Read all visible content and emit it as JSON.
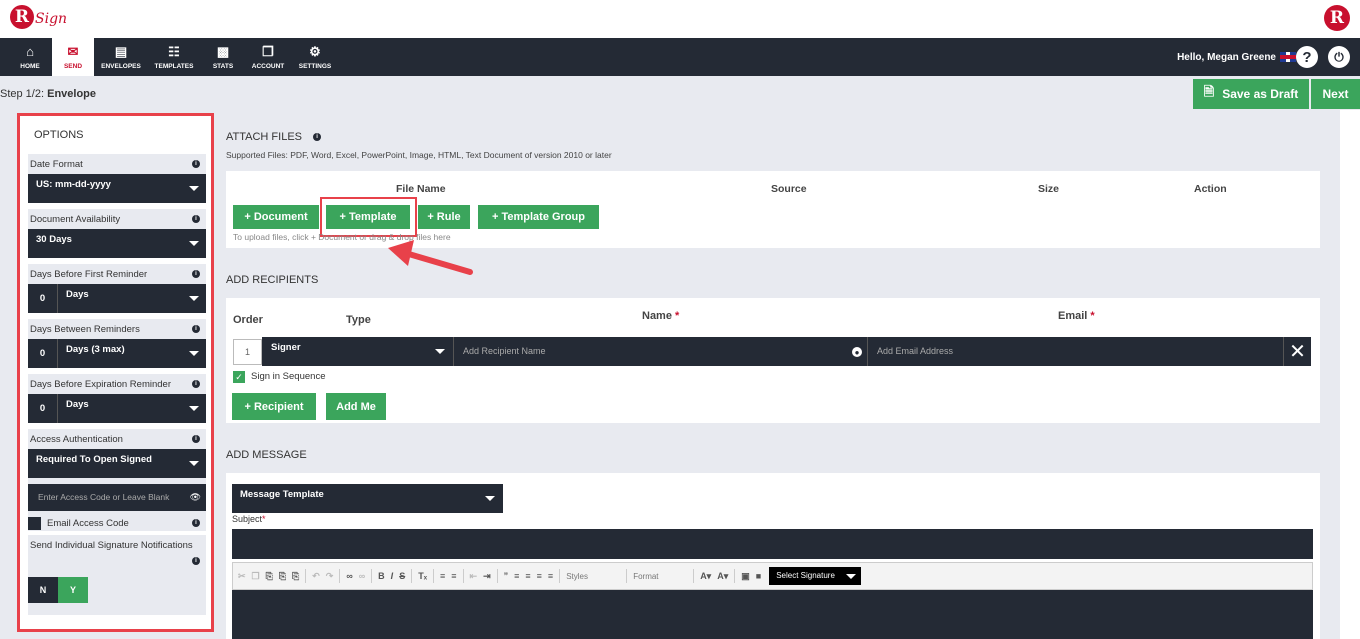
{
  "brand": {
    "logo_letter": "R",
    "logo_text": "Sign",
    "right_logo_letter": "R"
  },
  "nav": {
    "items": [
      {
        "label": "HOME",
        "icon": "home-icon"
      },
      {
        "label": "SEND",
        "icon": "envelope-icon"
      },
      {
        "label": "ENVELOPES",
        "icon": "inbox-icon"
      },
      {
        "label": "TEMPLATES",
        "icon": "templates-icon"
      },
      {
        "label": "STATS",
        "icon": "stats-icon"
      },
      {
        "label": "ACCOUNT",
        "icon": "account-icon"
      },
      {
        "label": "SETTINGS",
        "icon": "gear-icon"
      }
    ],
    "active": "SEND",
    "greeting": "Hello, Megan Greene"
  },
  "step": {
    "prefix": "Step 1/2:",
    "title": "Envelope"
  },
  "actions": {
    "save_draft": "Save as Draft",
    "next": "Next"
  },
  "options": {
    "title": "OPTIONS",
    "date_format": {
      "label": "Date Format",
      "value": "US: mm-dd-yyyy"
    },
    "doc_availability": {
      "label": "Document Availability",
      "value": "30 Days"
    },
    "first_reminder": {
      "label": "Days Before First Reminder",
      "num": "0",
      "value": "Days"
    },
    "between_reminders": {
      "label": "Days Between Reminders",
      "num": "0",
      "value": "Days (3 max)"
    },
    "expiration_reminder": {
      "label": "Days Before Expiration Reminder",
      "num": "0",
      "value": "Days"
    },
    "access_auth": {
      "label": "Access Authentication",
      "value": "Required To Open Signed",
      "code_placeholder": "Enter Access Code or Leave Blank"
    },
    "email_access_code": "Email Access Code",
    "individual_notifications": {
      "label": "Send Individual Signature Notifications",
      "no": "N",
      "yes": "Y"
    }
  },
  "attach": {
    "title": "ATTACH FILES",
    "supported": "Supported Files: PDF, Word, Excel, PowerPoint, Image, HTML, Text Document of version 2010 or later",
    "columns": [
      "File Name",
      "Source",
      "Size",
      "Action"
    ],
    "buttons": {
      "document": "+ Document",
      "template": "+ Template",
      "rule": "+ Rule",
      "template_group": "+ Template Group"
    },
    "hint": "To upload files, click + Document or drag & drop files here"
  },
  "recipients": {
    "title": "ADD RECIPIENTS",
    "columns": {
      "order": "Order",
      "type": "Type",
      "name": "Name",
      "email": "Email"
    },
    "row": {
      "order": "1",
      "type": "Signer",
      "name_placeholder": "Add Recipient Name",
      "email_placeholder": "Add Email Address"
    },
    "sign_in_sequence": "Sign in Sequence",
    "buttons": {
      "recipient": "+ Recipient",
      "add_me": "Add Me"
    }
  },
  "message": {
    "title": "ADD MESSAGE",
    "template_select": "Message Template",
    "subject_label": "Subject",
    "toolbar": {
      "styles": "Styles",
      "format": "Format",
      "signature": "Select Signature"
    }
  },
  "colors": {
    "dark": "#242a35",
    "green": "#3ba55c",
    "red": "#e8414a",
    "brand": "#c8102e"
  }
}
